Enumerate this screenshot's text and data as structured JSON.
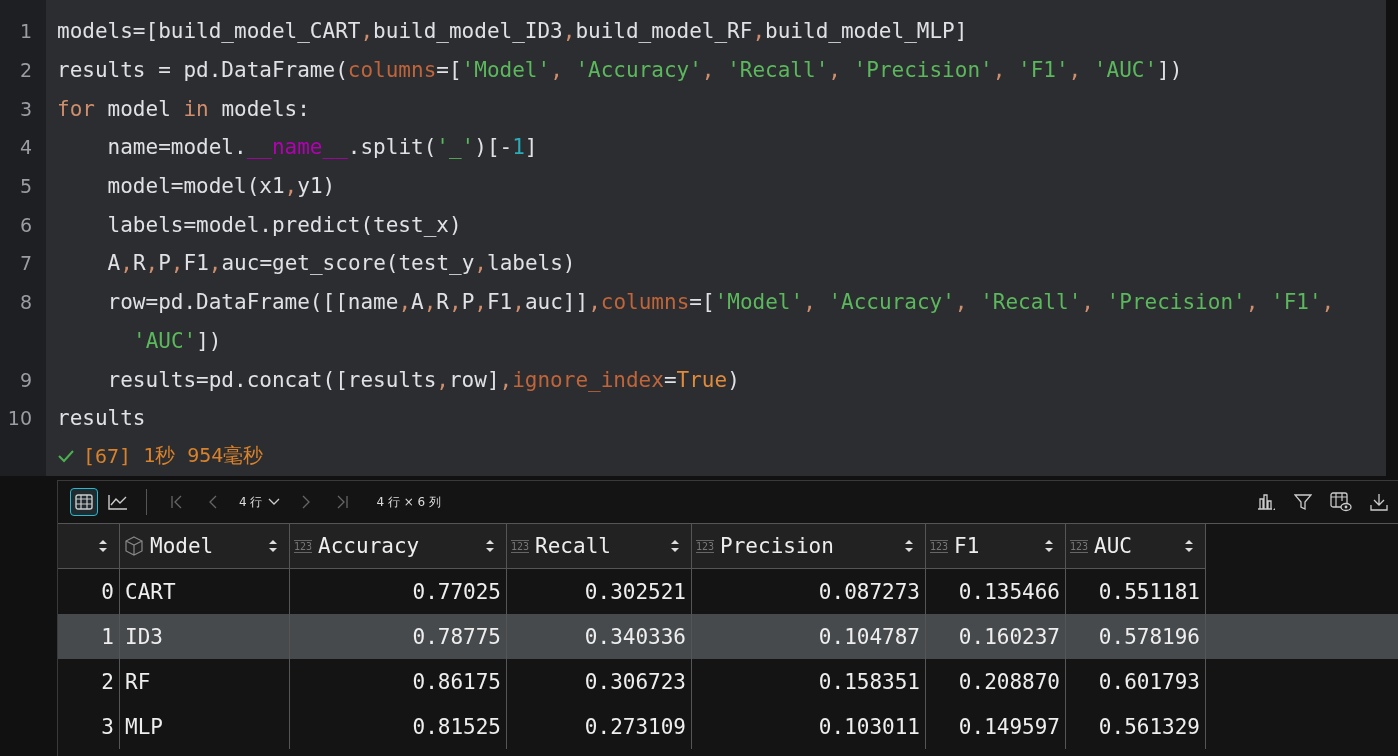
{
  "code": {
    "lines": [
      {
        "number": "1",
        "tokens": [
          {
            "t": "models=[build_model_CART",
            "kind": "plain"
          },
          {
            "t": ",",
            "kind": "punct"
          },
          {
            "t": "build_model_ID3",
            "kind": "plain"
          },
          {
            "t": ",",
            "kind": "punct"
          },
          {
            "t": "build_model_RF",
            "kind": "plain"
          },
          {
            "t": ",",
            "kind": "punct"
          },
          {
            "t": "build_model_MLP]",
            "kind": "plain"
          }
        ]
      },
      {
        "number": "2",
        "tokens": [
          {
            "t": "results = pd.DataFrame(",
            "kind": "plain"
          },
          {
            "t": "columns",
            "kind": "param"
          },
          {
            "t": "=[",
            "kind": "plain"
          },
          {
            "t": "'Model'",
            "kind": "str"
          },
          {
            "t": ", ",
            "kind": "punct"
          },
          {
            "t": "'Accuracy'",
            "kind": "str"
          },
          {
            "t": ", ",
            "kind": "punct"
          },
          {
            "t": "'Recall'",
            "kind": "str"
          },
          {
            "t": ", ",
            "kind": "punct"
          },
          {
            "t": "'Precision'",
            "kind": "str"
          },
          {
            "t": ", ",
            "kind": "punct"
          },
          {
            "t": "'F1'",
            "kind": "str"
          },
          {
            "t": ", ",
            "kind": "punct"
          },
          {
            "t": "'AUC'",
            "kind": "str"
          },
          {
            "t": "])",
            "kind": "plain"
          }
        ]
      },
      {
        "number": "3",
        "tokens": [
          {
            "t": "for",
            "kind": "kw"
          },
          {
            "t": " model ",
            "kind": "plain"
          },
          {
            "t": "in",
            "kind": "kw"
          },
          {
            "t": " models:",
            "kind": "plain"
          }
        ]
      },
      {
        "number": "4",
        "tokens": [
          {
            "t": "    name=model.",
            "kind": "plain"
          },
          {
            "t": "__name__",
            "kind": "dunder"
          },
          {
            "t": ".split(",
            "kind": "plain"
          },
          {
            "t": "'_'",
            "kind": "str"
          },
          {
            "t": ")[-",
            "kind": "plain"
          },
          {
            "t": "1",
            "kind": "num"
          },
          {
            "t": "]",
            "kind": "plain"
          }
        ]
      },
      {
        "number": "5",
        "tokens": [
          {
            "t": "    model=model(x1",
            "kind": "plain"
          },
          {
            "t": ",",
            "kind": "punct"
          },
          {
            "t": "y1)",
            "kind": "plain"
          }
        ]
      },
      {
        "number": "6",
        "tokens": [
          {
            "t": "    labels=model.predict(test_x)",
            "kind": "plain"
          }
        ]
      },
      {
        "number": "7",
        "tokens": [
          {
            "t": "    A",
            "kind": "plain"
          },
          {
            "t": ",",
            "kind": "punct"
          },
          {
            "t": "R",
            "kind": "plain"
          },
          {
            "t": ",",
            "kind": "punct"
          },
          {
            "t": "P",
            "kind": "plain"
          },
          {
            "t": ",",
            "kind": "punct"
          },
          {
            "t": "F1",
            "kind": "plain"
          },
          {
            "t": ",",
            "kind": "punct"
          },
          {
            "t": "auc=get_score(test_y",
            "kind": "plain"
          },
          {
            "t": ",",
            "kind": "punct"
          },
          {
            "t": "labels)",
            "kind": "plain"
          }
        ]
      },
      {
        "number": "8",
        "tokens": [
          {
            "t": "    row=pd.DataFrame([[name",
            "kind": "plain"
          },
          {
            "t": ",",
            "kind": "punct"
          },
          {
            "t": "A",
            "kind": "plain"
          },
          {
            "t": ",",
            "kind": "punct"
          },
          {
            "t": "R",
            "kind": "plain"
          },
          {
            "t": ",",
            "kind": "punct"
          },
          {
            "t": "P",
            "kind": "plain"
          },
          {
            "t": ",",
            "kind": "punct"
          },
          {
            "t": "F1",
            "kind": "plain"
          },
          {
            "t": ",",
            "kind": "punct"
          },
          {
            "t": "auc]]",
            "kind": "plain"
          },
          {
            "t": ",",
            "kind": "punct"
          },
          {
            "t": "columns",
            "kind": "param"
          },
          {
            "t": "=[",
            "kind": "plain"
          },
          {
            "t": "'Model'",
            "kind": "str"
          },
          {
            "t": ", ",
            "kind": "punct"
          },
          {
            "t": "'Accuracy'",
            "kind": "str"
          },
          {
            "t": ", ",
            "kind": "punct"
          },
          {
            "t": "'Recall'",
            "kind": "str"
          },
          {
            "t": ", ",
            "kind": "punct"
          },
          {
            "t": "'Precision'",
            "kind": "str"
          },
          {
            "t": ", ",
            "kind": "punct"
          },
          {
            "t": "'F1'",
            "kind": "str"
          },
          {
            "t": ",",
            "kind": "punct"
          }
        ]
      },
      {
        "continuation": true,
        "tokens": [
          {
            "t": "'AUC'",
            "kind": "str"
          },
          {
            "t": "])",
            "kind": "plain"
          }
        ]
      },
      {
        "number": "9",
        "tokens": [
          {
            "t": "    results=pd.concat([results",
            "kind": "plain"
          },
          {
            "t": ",",
            "kind": "punct"
          },
          {
            "t": "row]",
            "kind": "plain"
          },
          {
            "t": ",",
            "kind": "punct"
          },
          {
            "t": "ignore_index",
            "kind": "param"
          },
          {
            "t": "=",
            "kind": "plain"
          },
          {
            "t": "True",
            "kind": "const"
          },
          {
            "t": ")",
            "kind": "plain"
          }
        ]
      },
      {
        "number": "10",
        "tokens": [
          {
            "t": "results",
            "kind": "plain"
          }
        ]
      }
    ],
    "execution": {
      "succeeded": true,
      "count": "[67]",
      "duration": "1秒 954毫秒"
    }
  },
  "output": {
    "toolbar": {
      "views": [
        {
          "kind": "table",
          "selected": true
        },
        {
          "kind": "chart",
          "selected": false
        }
      ],
      "rows_selector": "4 行",
      "shape": "4 行 × 6 列"
    },
    "table": {
      "columns": [
        {
          "kind": "index"
        },
        {
          "label": "Model",
          "kind": "object"
        },
        {
          "label": "Accuracy",
          "kind": "number",
          "type_label": "123"
        },
        {
          "label": "Recall",
          "kind": "number",
          "type_label": "123"
        },
        {
          "label": "Precision",
          "kind": "number",
          "type_label": "123"
        },
        {
          "label": "F1",
          "kind": "number",
          "type_label": "123"
        },
        {
          "label": "AUC",
          "kind": "number",
          "type_label": "123"
        }
      ],
      "rows": [
        {
          "selected": false,
          "cells": [
            "0",
            "CART",
            "0.77025",
            "0.302521",
            "0.087273",
            "0.135466",
            "0.551181"
          ]
        },
        {
          "selected": true,
          "cells": [
            "1",
            "ID3",
            "0.78775",
            "0.340336",
            "0.104787",
            "0.160237",
            "0.578196"
          ]
        },
        {
          "selected": false,
          "cells": [
            "2",
            "RF",
            "0.86175",
            "0.306723",
            "0.158351",
            "0.208870",
            "0.601793"
          ]
        },
        {
          "selected": false,
          "cells": [
            "3",
            "MLP",
            "0.81525",
            "0.273109",
            "0.103011",
            "0.149597",
            "0.561329"
          ]
        }
      ]
    }
  }
}
